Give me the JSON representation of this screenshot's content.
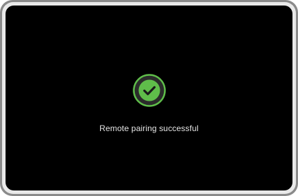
{
  "dialog": {
    "icon": "check-circle-icon",
    "message": "Remote pairing successful"
  },
  "colors": {
    "screen_background": "#000000",
    "success_accent": "#5fbd4a",
    "text": "#e6e6e6"
  }
}
